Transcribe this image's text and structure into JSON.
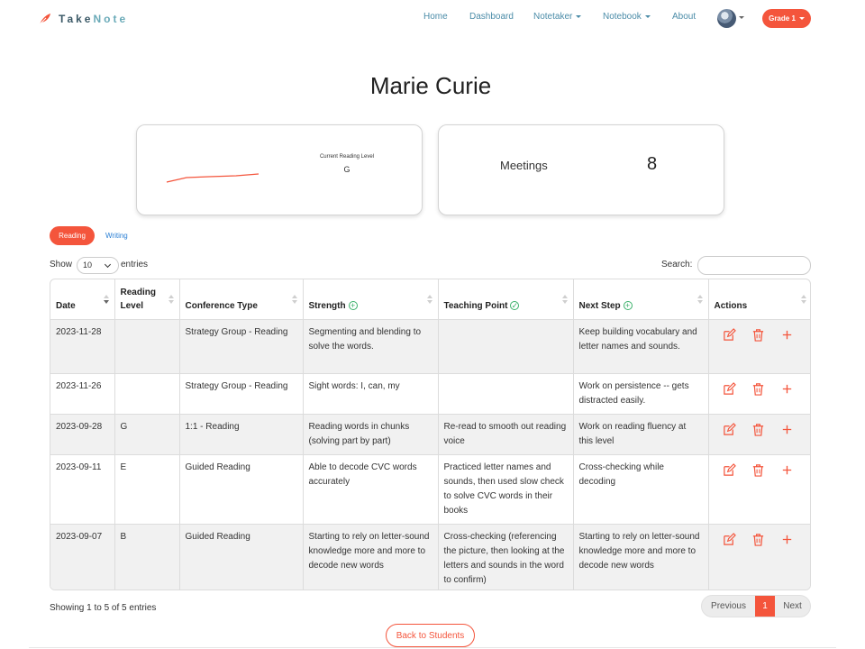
{
  "brand": {
    "name_part1": "Take",
    "name_part2": "Note"
  },
  "nav": {
    "home": "Home",
    "dashboard": "Dashboard",
    "notetaker": "Notetaker",
    "notebook": "Notebook",
    "about": "About",
    "grade": "Grade 1"
  },
  "student": {
    "name": "Marie Curie"
  },
  "reading_card": {
    "label": "Current Reading Level",
    "value": "G",
    "trend_line_color": "#f4553c"
  },
  "meetings_card": {
    "label": "Meetings",
    "value": "8"
  },
  "tabs": {
    "active": "Reading",
    "other": "Writing"
  },
  "controls": {
    "show": "Show",
    "page_size": "10",
    "entries": "entries",
    "search_label": "Search:"
  },
  "table": {
    "headers": {
      "date": "Date",
      "reading_level": "Reading Level",
      "conference_type": "Conference Type",
      "strength": "Strength",
      "teaching_point": "Teaching Point",
      "next_step": "Next Step",
      "actions": "Actions"
    },
    "rows": [
      {
        "date": "2023-11-28",
        "level": "",
        "type": "Strategy Group - Reading",
        "strength": "Segmenting and blending to solve the words.",
        "teaching_point": "",
        "next_step": "Keep building vocabulary and letter names and sounds."
      },
      {
        "date": "2023-11-26",
        "level": "",
        "type": "Strategy Group - Reading",
        "strength": "Sight words: I, can, my",
        "teaching_point": "",
        "next_step": "Work on persistence -- gets distracted easily."
      },
      {
        "date": "2023-09-28",
        "level": "G",
        "type": "1:1 - Reading",
        "strength": "Reading words in chunks (solving part by part)",
        "teaching_point": "Re-read to smooth out reading voice",
        "next_step": "Work on reading fluency at this level"
      },
      {
        "date": "2023-09-11",
        "level": "E",
        "type": "Guided Reading",
        "strength": "Able to decode CVC words accurately",
        "teaching_point": "Practiced letter names and sounds, then used slow check to solve CVC words in their books",
        "next_step": "Cross-checking while decoding"
      },
      {
        "date": "2023-09-07",
        "level": "B",
        "type": "Guided Reading",
        "strength": "Starting to rely on letter-sound knowledge more and more to decode new words",
        "teaching_point": "Cross-checking (referencing the picture, then looking at the letters and sounds in the word to confirm)",
        "next_step": "Starting to rely on letter-sound knowledge more and more to decode new words"
      }
    ]
  },
  "footer": {
    "showing": "Showing 1 to 5 of 5 entries",
    "previous": "Previous",
    "page": "1",
    "next": "Next",
    "back": "Back to Students"
  },
  "colors": {
    "accent": "#f4553c",
    "nav_link": "#4b8ca8",
    "check_green": "#3ab06a",
    "writing_link": "#2a7fd4"
  }
}
